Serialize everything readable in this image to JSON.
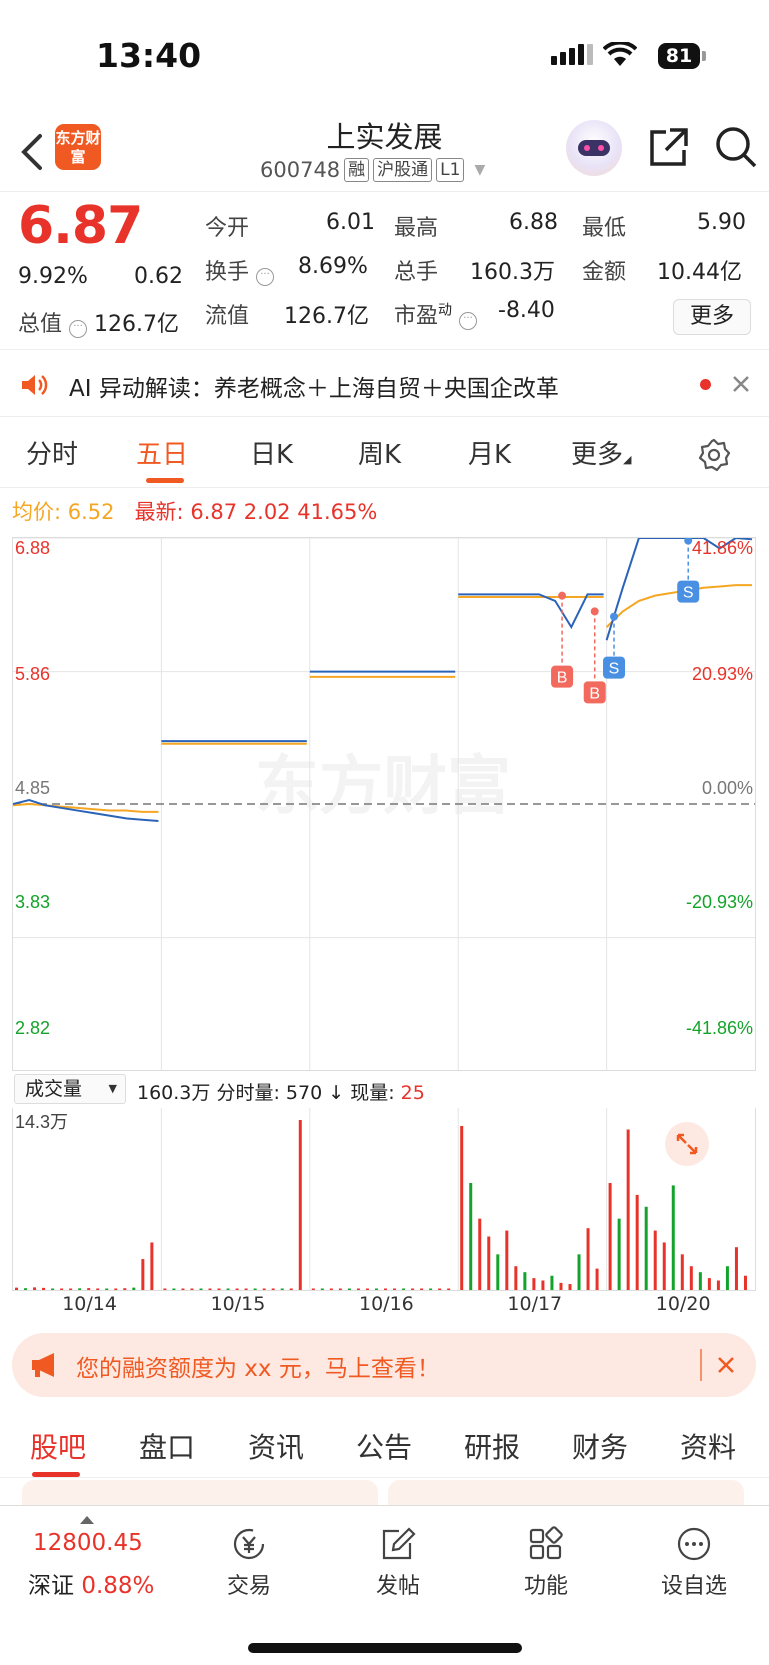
{
  "status_bar": {
    "time": "13:40",
    "battery": "81"
  },
  "header": {
    "logo_text": "东方财富",
    "stock_name": "上实发展",
    "stock_code": "600748",
    "tags": [
      "融",
      "沪股通",
      "L1"
    ]
  },
  "quote": {
    "price": "6.87",
    "change_pct": "9.92%",
    "change_amt": "0.62",
    "open_label": "今开",
    "open": "6.01",
    "high_label": "最高",
    "high": "6.88",
    "low_label": "最低",
    "low": "5.90",
    "turnover_label": "换手",
    "turnover": "8.69%",
    "total_vol_label": "总手",
    "total_vol": "160.3万",
    "amount_label": "金额",
    "amount": "10.44亿",
    "mktcap_label": "总值",
    "mktcap": "126.7亿",
    "float_label": "流值",
    "float_cap": "126.7亿",
    "pe_label": "市盈",
    "pe_sup": "动",
    "pe": "-8.40",
    "more_label": "更多"
  },
  "ai_banner": {
    "text": "AI 异动解读：养老概念＋上海自贸＋央国企改革"
  },
  "chart_tabs": {
    "items": [
      "分时",
      "五日",
      "日K",
      "周K",
      "月K",
      "更多"
    ],
    "active": "五日"
  },
  "chart_info": {
    "avg_label": "均价:",
    "avg": "6.52",
    "latest_label": "最新:",
    "latest": "6.87",
    "latest_chg": "2.02",
    "latest_pct": "41.65%"
  },
  "chart_data": {
    "type": "line",
    "series": [
      {
        "name": "均价"
      },
      {
        "name": "最新"
      }
    ],
    "y_left_ticks": [
      "6.88",
      "5.86",
      "4.85",
      "3.83",
      "2.82"
    ],
    "y_right_ticks": [
      "41.86%",
      "20.93%",
      "0.00%",
      "-20.93%",
      "-41.86%"
    ],
    "ylim": [
      2.82,
      6.88
    ],
    "base": 4.85,
    "x_days": [
      "10/14",
      "10/15",
      "10/16",
      "10/17",
      "10/20"
    ],
    "price_by_day": [
      [
        4.85,
        4.88,
        4.84,
        4.82,
        4.8,
        4.78,
        4.76,
        4.74,
        4.73,
        4.72
      ],
      [
        5.33,
        5.33,
        5.33,
        5.33,
        5.33,
        5.33,
        5.33,
        5.33,
        5.33,
        5.33
      ],
      [
        5.86,
        5.86,
        5.86,
        5.86,
        5.86,
        5.86,
        5.86,
        5.86,
        5.86,
        5.86
      ],
      [
        6.45,
        6.45,
        6.45,
        6.45,
        6.45,
        6.45,
        6.4,
        6.2,
        6.45,
        6.45
      ],
      [
        6.1,
        6.5,
        6.88,
        6.88,
        6.88,
        6.88,
        6.88,
        6.8,
        6.88,
        6.87
      ]
    ],
    "avg_by_day": [
      [
        4.84,
        4.85,
        4.84,
        4.83,
        4.82,
        4.81,
        4.8,
        4.8,
        4.79,
        4.79
      ],
      [
        5.31,
        5.31,
        5.31,
        5.31,
        5.31,
        5.31,
        5.31,
        5.31,
        5.31,
        5.31
      ],
      [
        5.82,
        5.82,
        5.82,
        5.82,
        5.82,
        5.82,
        5.82,
        5.82,
        5.82,
        5.82
      ],
      [
        6.43,
        6.43,
        6.43,
        6.43,
        6.43,
        6.43,
        6.43,
        6.43,
        6.43,
        6.43
      ],
      [
        6.2,
        6.32,
        6.4,
        6.44,
        6.46,
        6.48,
        6.5,
        6.51,
        6.52,
        6.52
      ]
    ],
    "markers": [
      {
        "label": "B",
        "day": 3,
        "pos": 0.7,
        "price": 6.44
      },
      {
        "label": "B",
        "day": 3,
        "pos": 0.92,
        "price": 6.32
      },
      {
        "label": "S",
        "day": 4,
        "pos": 0.05,
        "price": 6.28
      },
      {
        "label": "S",
        "day": 4,
        "pos": 0.55,
        "price": 6.86
      }
    ]
  },
  "volume": {
    "selector": "成交量",
    "total": "160.3万",
    "period_label": "分时量:",
    "period_val": "570",
    "current_label": "现量:",
    "current_val": "25",
    "max_label": "14.3万",
    "max_value": 143000,
    "bars_by_day": [
      [
        2000,
        1500,
        2200,
        1800,
        1200,
        1000,
        900,
        1400,
        1600,
        1300,
        1100,
        800,
        1500,
        2000,
        26000,
        40000
      ],
      [
        1000,
        800,
        600,
        500,
        400,
        700,
        600,
        500,
        400,
        300,
        500,
        600,
        800,
        900,
        1000,
        143000
      ],
      [
        500,
        400,
        300,
        400,
        500,
        300,
        200,
        300,
        400,
        500,
        300,
        200,
        300,
        400,
        500,
        600
      ],
      [
        138000,
        90000,
        60000,
        45000,
        30000,
        50000,
        20000,
        15000,
        10000,
        8000,
        12000,
        6000,
        5000,
        30000,
        52000,
        18000
      ],
      [
        90000,
        60000,
        135000,
        80000,
        70000,
        50000,
        40000,
        88000,
        30000,
        20000,
        15000,
        10000,
        8000,
        20000,
        36000,
        12000
      ]
    ]
  },
  "promo": {
    "text": "您的融资额度为 xx 元，马上查看！"
  },
  "bottom_tabs": {
    "items": [
      "股吧",
      "盘口",
      "资讯",
      "公告",
      "研报",
      "财务",
      "资料"
    ],
    "active": "股吧"
  },
  "footer": {
    "index_value": "12800.45",
    "index_name": "深证",
    "index_pct": "0.88%",
    "items": [
      "交易",
      "发帖",
      "功能",
      "设自选"
    ]
  },
  "colors": {
    "up": "#e8332a",
    "down": "#14a32a",
    "price_line": "#2b63b8",
    "avg_line": "#f5a623",
    "brand": "#f05a22"
  }
}
